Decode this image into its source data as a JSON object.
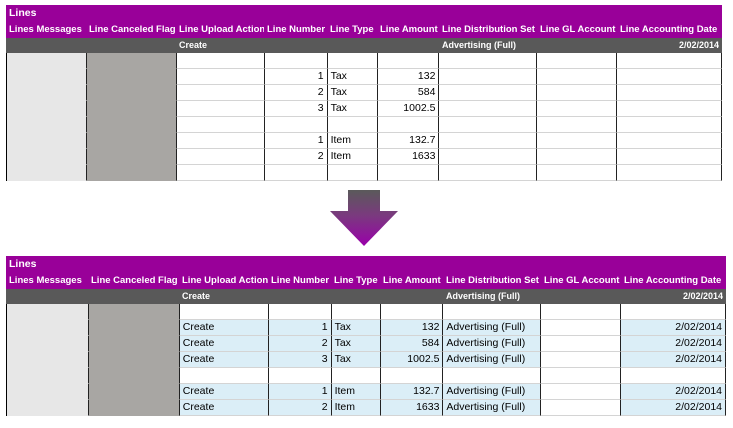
{
  "before": {
    "title": "Lines",
    "columns": [
      "Lines Messages",
      "Line Canceled Flag",
      "Line Upload Action",
      "Line Number",
      "Line Type",
      "Line Amount",
      "Line Distribution Set",
      "Line GL Account",
      "Line Accounting Date"
    ],
    "subheader": {
      "upload_action": "Create",
      "distribution_set": "Advertising (Full)",
      "accounting_date": "2/02/2014"
    },
    "rows": [
      {
        "action": "",
        "number": "",
        "type": "",
        "amount": "",
        "dist": "",
        "gl": "",
        "date": ""
      },
      {
        "action": "",
        "number": "1",
        "type": "Tax",
        "amount": "132",
        "dist": "",
        "gl": "",
        "date": ""
      },
      {
        "action": "",
        "number": "2",
        "type": "Tax",
        "amount": "584",
        "dist": "",
        "gl": "",
        "date": ""
      },
      {
        "action": "",
        "number": "3",
        "type": "Tax",
        "amount": "1002.5",
        "dist": "",
        "gl": "",
        "date": ""
      },
      {
        "action": "",
        "number": "",
        "type": "",
        "amount": "",
        "dist": "",
        "gl": "",
        "date": ""
      },
      {
        "action": "",
        "number": "1",
        "type": "Item",
        "amount": "132.7",
        "dist": "",
        "gl": "",
        "date": ""
      },
      {
        "action": "",
        "number": "2",
        "type": "Item",
        "amount": "1633",
        "dist": "",
        "gl": "",
        "date": ""
      },
      {
        "action": "",
        "number": "",
        "type": "",
        "amount": "",
        "dist": "",
        "gl": "",
        "date": ""
      }
    ]
  },
  "after": {
    "title": "Lines",
    "columns": [
      "Lines Messages",
      "Line Canceled Flag",
      "Line Upload Action",
      "Line Number",
      "Line Type",
      "Line Amount",
      "Line Distribution Set",
      "Line GL Account",
      "Line Accounting Date"
    ],
    "subheader": {
      "upload_action": "Create",
      "distribution_set": "Advertising (Full)",
      "accounting_date": "2/02/2014"
    },
    "rows": [
      {
        "action": "",
        "number": "",
        "type": "",
        "amount": "",
        "dist": "",
        "gl": "",
        "date": ""
      },
      {
        "action": "Create",
        "number": "1",
        "type": "Tax",
        "amount": "132",
        "dist": "Advertising (Full)",
        "gl": "",
        "date": "2/02/2014"
      },
      {
        "action": "Create",
        "number": "2",
        "type": "Tax",
        "amount": "584",
        "dist": "Advertising (Full)",
        "gl": "",
        "date": "2/02/2014"
      },
      {
        "action": "Create",
        "number": "3",
        "type": "Tax",
        "amount": "1002.5",
        "dist": "Advertising (Full)",
        "gl": "",
        "date": "2/02/2014"
      },
      {
        "action": "",
        "number": "",
        "type": "",
        "amount": "",
        "dist": "",
        "gl": "",
        "date": ""
      },
      {
        "action": "Create",
        "number": "1",
        "type": "Item",
        "amount": "132.7",
        "dist": "Advertising (Full)",
        "gl": "",
        "date": "2/02/2014"
      },
      {
        "action": "Create",
        "number": "2",
        "type": "Item",
        "amount": "1633",
        "dist": "Advertising (Full)",
        "gl": "",
        "date": "2/02/2014"
      }
    ]
  },
  "arrow": {
    "icon": "down-arrow-icon",
    "color_top": "#5a5a5a",
    "color_bottom": "#9900aa"
  },
  "colors": {
    "header": "#990099",
    "subheader": "#595959",
    "highlight": "#dbeef7",
    "messages_col": "#e7e7e7",
    "flag_col": "#a8a6a3"
  }
}
